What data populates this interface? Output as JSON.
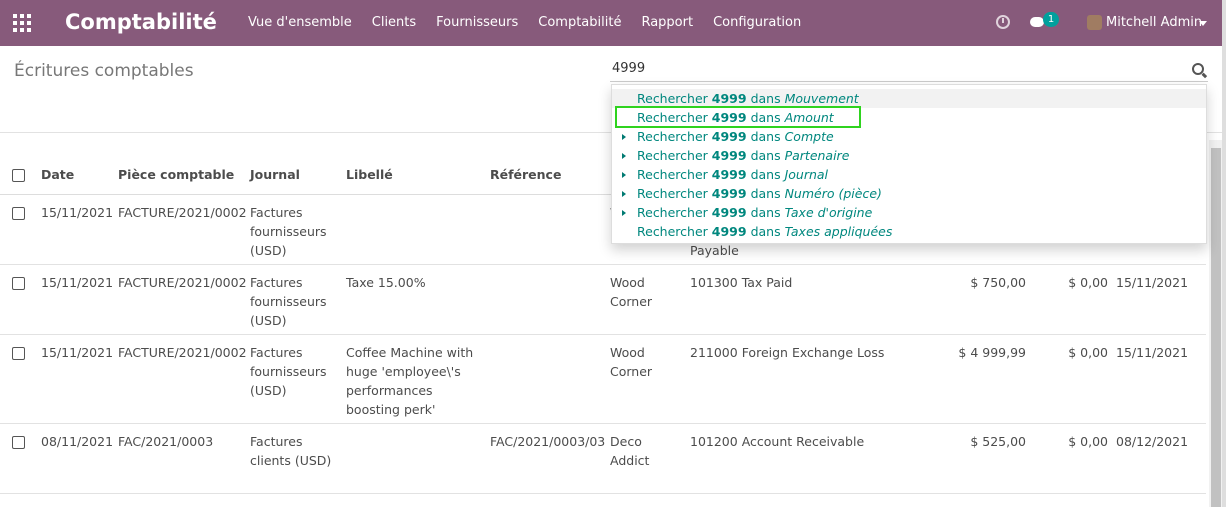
{
  "nav": {
    "brand": "Comptabilité",
    "menu": [
      "Vue d'ensemble",
      "Clients",
      "Fournisseurs",
      "Comptabilité",
      "Rapport",
      "Configuration"
    ],
    "chat_count": "1",
    "user": "Mitchell Admin"
  },
  "page": {
    "title": "Écritures comptables",
    "search_value": "4999"
  },
  "dropdown": [
    {
      "prefix": "Rechercher",
      "term": "4999",
      "dans": "dans",
      "field": "Mouvement",
      "expandable": false
    },
    {
      "prefix": "Rechercher",
      "term": "4999",
      "dans": "dans",
      "field": "Amount",
      "expandable": false
    },
    {
      "prefix": "Rechercher",
      "term": "4999",
      "dans": "dans",
      "field": "Compte",
      "expandable": true
    },
    {
      "prefix": "Rechercher",
      "term": "4999",
      "dans": "dans",
      "field": "Partenaire",
      "expandable": true
    },
    {
      "prefix": "Rechercher",
      "term": "4999",
      "dans": "dans",
      "field": "Journal",
      "expandable": true
    },
    {
      "prefix": "Rechercher",
      "term": "4999",
      "dans": "dans",
      "field": "Numéro (pièce)",
      "expandable": true
    },
    {
      "prefix": "Rechercher",
      "term": "4999",
      "dans": "dans",
      "field": "Taxe d'origine",
      "expandable": true
    },
    {
      "prefix": "Rechercher",
      "term": "4999",
      "dans": "dans",
      "field": "Taxes appliquées",
      "expandable": false
    }
  ],
  "table": {
    "headers": [
      "Date",
      "Pièce comptable",
      "Journal",
      "Libellé",
      "Référence",
      "P"
    ],
    "rows": [
      {
        "date": "15/11/2021",
        "piece": "FACTURE/2021/0002",
        "journal": "Factures fournisseurs (USD)",
        "libelle": "",
        "reference": "",
        "partner": "W C",
        "account": "Payable",
        "debit": "",
        "credit": "",
        "due": ""
      },
      {
        "date": "15/11/2021",
        "piece": "FACTURE/2021/0002",
        "journal": "Factures fournisseurs (USD)",
        "libelle": "Taxe 15.00%",
        "reference": "",
        "partner": "Wood Corner",
        "account": "101300 Tax Paid",
        "debit": "$ 750,00",
        "credit": "$ 0,00",
        "due": "15/11/2021"
      },
      {
        "date": "15/11/2021",
        "piece": "FACTURE/2021/0002",
        "journal": "Factures fournisseurs (USD)",
        "libelle": "Coffee Machine with huge 'employee\\'s performances boosting perk'",
        "reference": "",
        "partner": "Wood Corner",
        "account": "211000 Foreign Exchange Loss",
        "debit": "$ 4 999,99",
        "credit": "$ 0,00",
        "due": "15/11/2021"
      },
      {
        "date": "08/11/2021",
        "piece": "FAC/2021/0003",
        "journal": "Factures clients (USD)",
        "libelle": "",
        "reference": "FAC/2021/0003/03",
        "partner": "Deco Addict",
        "account": "101200 Account Receivable",
        "debit": "$ 525,00",
        "credit": "$ 0,00",
        "due": "08/12/2021"
      }
    ]
  }
}
